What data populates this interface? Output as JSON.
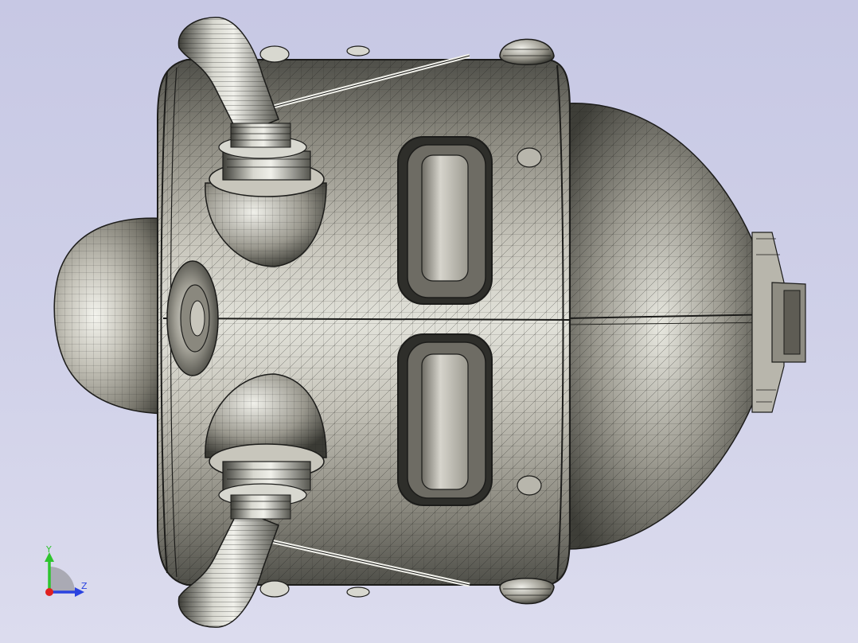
{
  "viewport": {
    "background_top": "#c7c8e4",
    "background_bottom": "#dcdcee",
    "model_fill": "#a8a69a",
    "model_light": "#e4e4dc",
    "model_dark": "#4a4a44",
    "mesh_color": "#1c1c1a"
  },
  "triad": {
    "y_label": "Y",
    "z_label": "Z",
    "y_color": "#2ec42e",
    "z_color": "#2a42e0",
    "x_color": "#e02020"
  }
}
